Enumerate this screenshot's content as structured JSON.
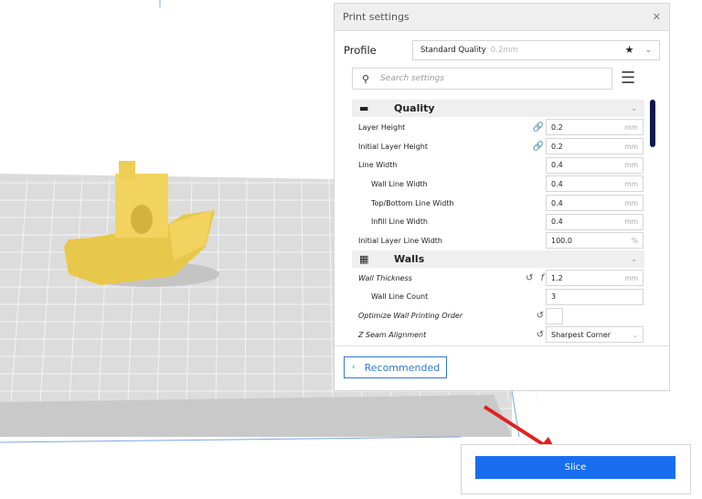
{
  "panel": {
    "title": "Print settings",
    "close_icon": "close-icon",
    "profile": {
      "label": "Profile",
      "value": "Standard Quality",
      "sub": "0.2mm"
    },
    "search": {
      "placeholder": "Search settings"
    },
    "categories": [
      {
        "name": "Quality",
        "icon": "quality-bars-icon",
        "rows": [
          {
            "label": "Layer Height",
            "value": "0.2",
            "unit": "mm",
            "link": true
          },
          {
            "label": "Initial Layer Height",
            "value": "0.2",
            "unit": "mm",
            "link": true
          },
          {
            "label": "Line Width",
            "value": "0.4",
            "unit": "mm"
          },
          {
            "label": "Wall Line Width",
            "value": "0.4",
            "unit": "mm",
            "indent": true
          },
          {
            "label": "Top/Bottom Line Width",
            "value": "0.4",
            "unit": "mm",
            "indent": true
          },
          {
            "label": "Infill Line Width",
            "value": "0.4",
            "unit": "mm",
            "indent": true
          },
          {
            "label": "Initial Layer Line Width",
            "value": "100.0",
            "unit": "%"
          }
        ]
      },
      {
        "name": "Walls",
        "icon": "walls-grid-icon",
        "rows": [
          {
            "label": "Wall Thickness",
            "value": "1.2",
            "unit": "mm",
            "italic": true,
            "reset": true,
            "formula": true
          },
          {
            "label": "Wall Line Count",
            "value": "3",
            "unit": "",
            "indent": true
          },
          {
            "label": "Optimize Wall Printing Order",
            "checkbox": true,
            "checked": false,
            "italic": true,
            "reset": true
          },
          {
            "label": "Z Seam Alignment",
            "value": "Sharpest Corner",
            "dropdown": true,
            "italic": true,
            "reset": true
          }
        ]
      }
    ],
    "recommended_label": "Recommended"
  },
  "slice_label": "Slice",
  "colors": {
    "accent": "#196ef0",
    "model": "#f2d35f",
    "scroll": "#0e1a4d",
    "arrow": "#e02020"
  }
}
